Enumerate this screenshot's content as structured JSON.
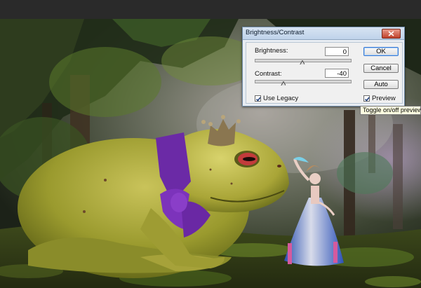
{
  "dialog": {
    "title": "Brightness/Contrast",
    "brightness": {
      "label": "Brightness:",
      "value": "0",
      "level": 0.5
    },
    "contrast": {
      "label": "Contrast:",
      "value": "-40",
      "level": 0.3
    },
    "use_legacy": {
      "label": "Use Legacy",
      "checked": true
    },
    "preview": {
      "label": "Preview",
      "checked": true
    },
    "buttons": {
      "ok": "OK",
      "cancel": "Cancel",
      "auto": "Auto"
    }
  },
  "tooltip": {
    "text": "Toggle on/off preview i"
  },
  "icons": {
    "close": "close-icon",
    "checkmark": "checkmark-icon",
    "slider": "slider-thumb-icon"
  },
  "colors": {
    "dialog_border": "#6f8aa6",
    "ok_border": "#3a7bd5",
    "tooltip_bg": "#ffffe1"
  }
}
